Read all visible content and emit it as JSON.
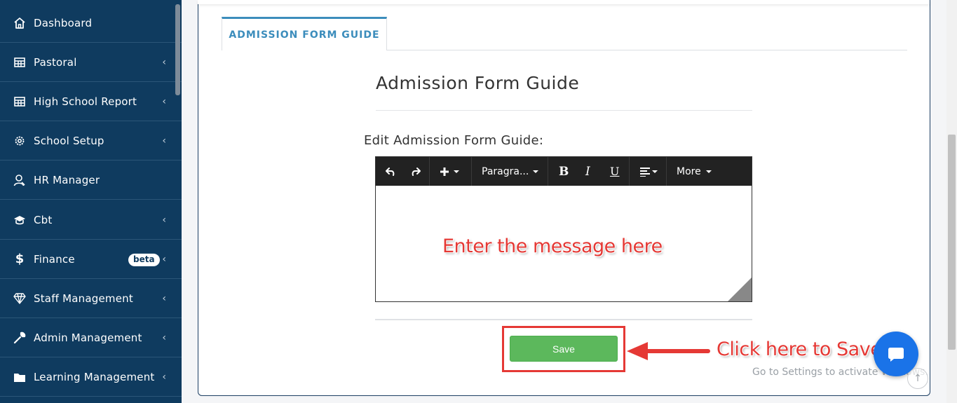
{
  "sidebar": {
    "items": [
      {
        "label": "Dashboard",
        "icon": "home-icon",
        "has_chevron": false
      },
      {
        "label": "Pastoral",
        "icon": "table-icon",
        "has_chevron": true
      },
      {
        "label": "High School Report",
        "icon": "table-icon",
        "has_chevron": true
      },
      {
        "label": "School Setup",
        "icon": "gear-icon",
        "has_chevron": true
      },
      {
        "label": "HR Manager",
        "icon": "user-icon",
        "has_chevron": false
      },
      {
        "label": "Cbt",
        "icon": "graduation-cap-icon",
        "has_chevron": true
      },
      {
        "label": "Finance",
        "icon": "dollar-icon",
        "has_chevron": true,
        "badge": "beta"
      },
      {
        "label": "Staff Management",
        "icon": "diamond-icon",
        "has_chevron": true
      },
      {
        "label": "Admin Management",
        "icon": "wrench-icon",
        "has_chevron": true
      },
      {
        "label": "Learning Management",
        "icon": "folder-icon",
        "has_chevron": true
      }
    ],
    "chevron": "‹"
  },
  "tab": {
    "label": "ADMISSION FORM GUIDE"
  },
  "content": {
    "title": "Admission Form Guide",
    "edit_label": "Edit Admission Form Guide:"
  },
  "editor": {
    "paragraph_label": "Paragra...",
    "more_label": "More",
    "bold": "B",
    "italic": "I",
    "underline": "U"
  },
  "annotations": {
    "editor_hint": "Enter the message here",
    "save_hint": "Click here to Save."
  },
  "save_button": {
    "label": "Save"
  },
  "watermark": {
    "text": "Go to Settings to activate Windows."
  },
  "colors": {
    "sidebar_bg": "#0f3b5f",
    "accent": "#3c8dbc",
    "save_green": "#5cb85c",
    "annotation_red": "#e53935",
    "chat_blue": "#1a73e8"
  }
}
